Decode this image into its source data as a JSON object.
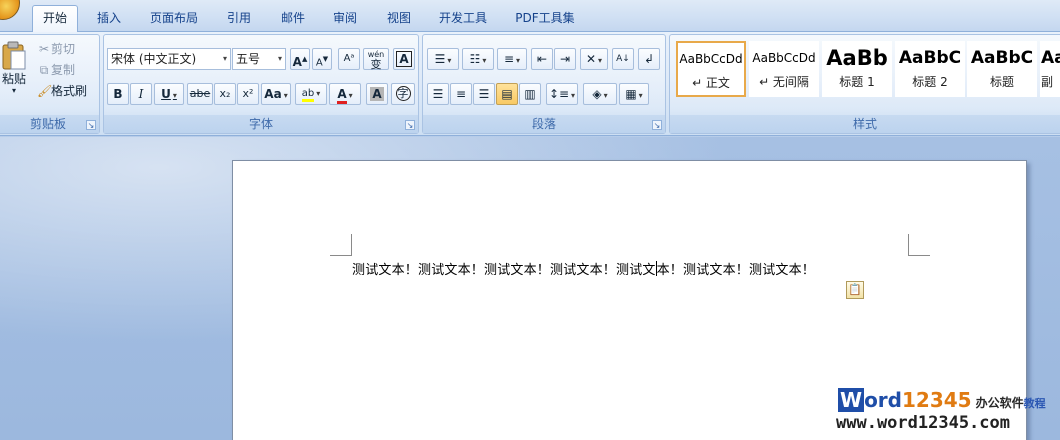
{
  "tabs": [
    {
      "label": "开始",
      "active": true
    },
    {
      "label": "插入"
    },
    {
      "label": "页面布局"
    },
    {
      "label": "引用"
    },
    {
      "label": "邮件"
    },
    {
      "label": "审阅"
    },
    {
      "label": "视图"
    },
    {
      "label": "开发工具"
    },
    {
      "label": "PDF工具集"
    }
  ],
  "clipboard": {
    "group_label": "剪贴板",
    "paste_label": "粘贴",
    "cut_label": "剪切",
    "copy_label": "复制",
    "format_painter_label": "格式刷"
  },
  "font": {
    "group_label": "字体",
    "font_name": "宋体 (中文正文)",
    "font_size": "五号",
    "grow_font": "A",
    "shrink_font": "A",
    "phonetic_guide": "wén",
    "phonetic_char": "变",
    "char_border": "A",
    "bold": "B",
    "italic": "I",
    "underline": "U",
    "strikethrough": "abe",
    "subscript": "x₂",
    "superscript": "x²",
    "change_case": "Aa",
    "highlight": "ab",
    "font_color": "A",
    "char_shading": "A",
    "enclose_char": "字"
  },
  "paragraph": {
    "group_label": "段落"
  },
  "styles": {
    "group_label": "样式",
    "items": [
      {
        "sample": "AaBbCcDd",
        "name": "↵ 正文",
        "selected": true
      },
      {
        "sample": "AaBbCcDd",
        "name": "↵ 无间隔"
      },
      {
        "sample": "AaBb",
        "name": "标题 1"
      },
      {
        "sample": "AaBbC",
        "name": "标题 2"
      },
      {
        "sample": "AaBbC",
        "name": "标题"
      },
      {
        "sample": "Aa",
        "name": "副"
      }
    ]
  },
  "document": {
    "text_before_caret": "测试文本！测试文本！测试文本！测试文本！测试文",
    "text_after_caret": "本！测试文本！测试文本！"
  },
  "watermark": {
    "logo_w": "W",
    "logo_ord": "ord",
    "logo_num": "12345",
    "logo_cn": "办公软件",
    "logo_cn2": "教程",
    "url": "www.word12345.com"
  },
  "colors": {
    "accent": "#15428b",
    "ribbon_bg": "#dce8f7",
    "highlight_yellow": "#ffff00",
    "font_color_red": "#e02020"
  }
}
